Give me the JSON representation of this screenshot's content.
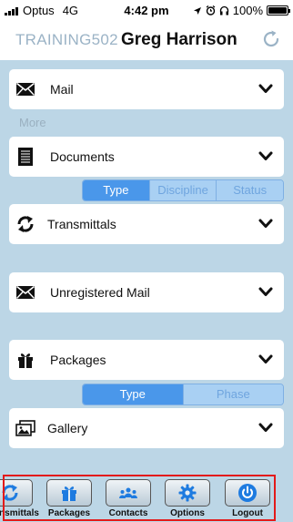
{
  "status_bar": {
    "carrier": "Optus",
    "network": "4G",
    "time": "4:42 pm",
    "battery": "100%",
    "battery_level": 1.0
  },
  "header": {
    "code": "TRAINING502",
    "user": "Greg Harrison"
  },
  "sections": {
    "mail": "Mail",
    "more": "More",
    "documents": "Documents",
    "transmittals": "Transmittals",
    "unregistered_mail": "Unregistered Mail",
    "packages": "Packages",
    "gallery": "Gallery"
  },
  "documents_sort": {
    "options": [
      "Type",
      "Discipline",
      "Status"
    ],
    "selected": "Type"
  },
  "packages_sort": {
    "options": [
      "Type",
      "Phase"
    ],
    "selected": "Type"
  },
  "tabbar": {
    "tabs": [
      "nsmittals",
      "Packages",
      "Contacts",
      "Options",
      "Logout"
    ],
    "accent_color": "#1e7be0",
    "highlight_color": "#e31a1a"
  }
}
